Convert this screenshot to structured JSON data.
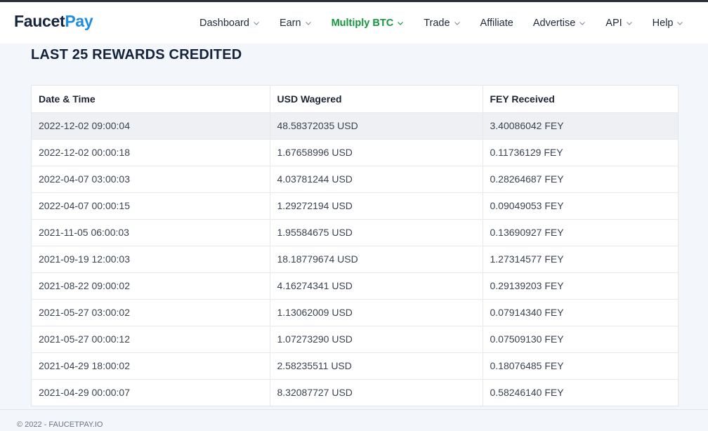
{
  "brand": {
    "part1": "Faucet",
    "part2": "Pay"
  },
  "nav": {
    "items": [
      {
        "label": "Dashboard",
        "dropdown": true,
        "active": false
      },
      {
        "label": "Earn",
        "dropdown": true,
        "active": false
      },
      {
        "label": "Multiply BTC",
        "dropdown": true,
        "active": true
      },
      {
        "label": "Trade",
        "dropdown": true,
        "active": false
      },
      {
        "label": "Affiliate",
        "dropdown": false,
        "active": false
      },
      {
        "label": "Advertise",
        "dropdown": true,
        "active": false
      },
      {
        "label": "API",
        "dropdown": true,
        "active": false
      },
      {
        "label": "Help",
        "dropdown": true,
        "active": false
      }
    ]
  },
  "page": {
    "title": "LAST 25 REWARDS CREDITED"
  },
  "table": {
    "headers": [
      "Date & Time",
      "USD Wagered",
      "FEY Received"
    ],
    "rows": [
      [
        "2022-12-02 09:00:04",
        "48.58372035 USD",
        "3.40086042 FEY"
      ],
      [
        "2022-12-02 00:00:18",
        "1.67658996 USD",
        "0.11736129 FEY"
      ],
      [
        "2022-04-07 03:00:03",
        "4.03781244 USD",
        "0.28264687 FEY"
      ],
      [
        "2022-04-07 00:00:15",
        "1.29272194 USD",
        "0.09049053 FEY"
      ],
      [
        "2021-11-05 06:00:03",
        "1.95584675 USD",
        "0.13690927 FEY"
      ],
      [
        "2021-09-19 12:00:03",
        "18.18779674 USD",
        "1.27314577 FEY"
      ],
      [
        "2021-08-22 09:00:02",
        "4.16274341 USD",
        "0.29139203 FEY"
      ],
      [
        "2021-05-27 03:00:02",
        "1.13062009 USD",
        "0.07914340 FEY"
      ],
      [
        "2021-05-27 00:00:12",
        "1.07273290 USD",
        "0.07509130 FEY"
      ],
      [
        "2021-04-29 18:00:02",
        "2.58235511 USD",
        "0.18076485 FEY"
      ],
      [
        "2021-04-29 00:00:07",
        "8.32087727 USD",
        "0.58246140 FEY"
      ]
    ]
  },
  "footer": {
    "text": "© 2022 - FAUCETPAY.IO"
  },
  "colors": {
    "brand_dark": "#13243f",
    "brand_blue": "#1f8de0",
    "active_nav": "#14963b"
  }
}
